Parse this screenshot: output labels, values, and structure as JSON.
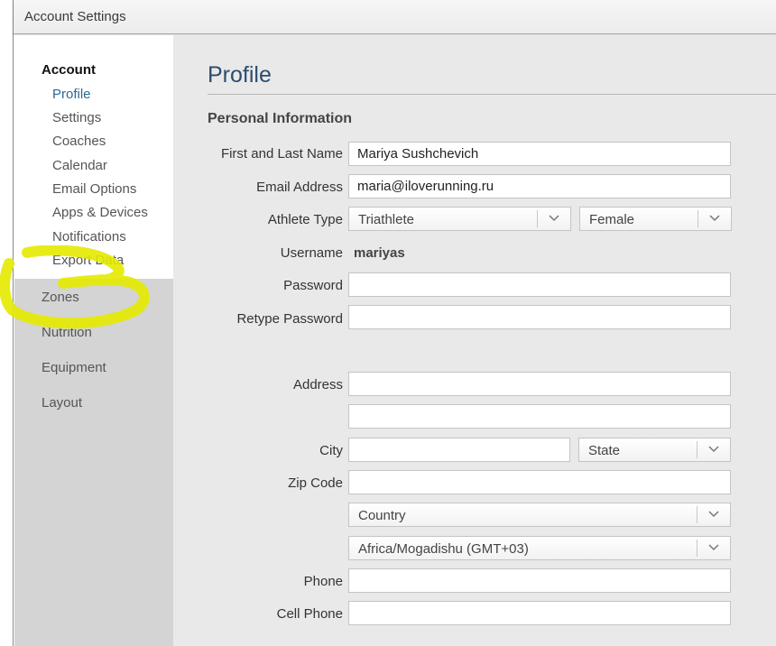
{
  "window": {
    "title": "Account Settings"
  },
  "sidebar": {
    "account_heading": "Account",
    "account_items": [
      {
        "label": "Profile",
        "active": true
      },
      {
        "label": "Settings"
      },
      {
        "label": "Coaches"
      },
      {
        "label": "Calendar"
      },
      {
        "label": "Email Options"
      },
      {
        "label": "Apps & Devices"
      },
      {
        "label": "Notifications"
      },
      {
        "label": "Export Data"
      }
    ],
    "groups": [
      {
        "label": "Zones"
      },
      {
        "label": "Nutrition"
      },
      {
        "label": "Equipment"
      },
      {
        "label": "Layout"
      }
    ]
  },
  "main": {
    "page_title": "Profile",
    "section_title": "Personal Information",
    "fields": {
      "name": {
        "label": "First and Last Name",
        "value": "Mariya Sushchevich"
      },
      "email": {
        "label": "Email Address",
        "value": "maria@iloverunning.ru"
      },
      "athlete_type": {
        "label": "Athlete Type",
        "value": "Triathlete"
      },
      "gender": {
        "value": "Female"
      },
      "username": {
        "label": "Username",
        "value": "mariyas"
      },
      "password": {
        "label": "Password",
        "value": ""
      },
      "retype_password": {
        "label": "Retype Password",
        "value": ""
      },
      "address": {
        "label": "Address",
        "value": ""
      },
      "address2": {
        "value": ""
      },
      "city": {
        "label": "City",
        "value": ""
      },
      "state": {
        "value": "State"
      },
      "zip": {
        "label": "Zip Code",
        "value": ""
      },
      "country": {
        "value": "Country"
      },
      "timezone": {
        "value": "Africa/Mogadishu (GMT+03)"
      },
      "phone": {
        "label": "Phone",
        "value": ""
      },
      "cell_phone": {
        "label": "Cell Phone",
        "value": ""
      }
    }
  },
  "colors": {
    "accent": "#2c6a91",
    "title": "#2c4d6e",
    "highlight": "#e4ea00"
  }
}
